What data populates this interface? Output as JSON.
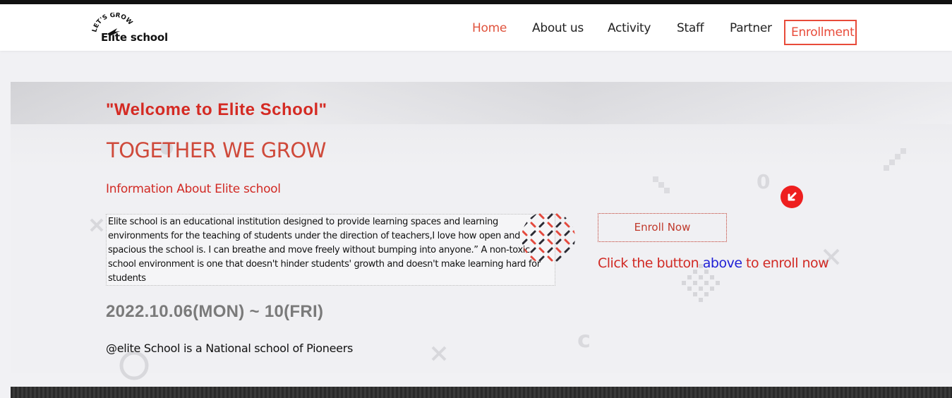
{
  "brand": {
    "arc_text": "LET'S GROW",
    "name": "Elite school"
  },
  "nav": {
    "home": "Home",
    "about": "About us",
    "activity": "Activity",
    "staff": "Staff",
    "partner": "Partner",
    "enrollment": "Enrollment"
  },
  "hero": {
    "welcome": "\"Welcome to Elite School\"",
    "tagline": "TOGETHER WE GROW",
    "info_heading": "Information About Elite school",
    "description": "Elite school is an educational institution designed to provide learning spaces and learning environments for the teaching of students under the direction of teachers,I love how open and spacious the school is. I can breathe and move freely without bumping into anyone.” A non-toxic school environment is one that doesn't hinder students' growth and doesn't make learning hard for students",
    "dates": "2022.10.06(MON) ~ 10(FRI)",
    "footer_note": "@elite School is a National school of Pioneers"
  },
  "enroll": {
    "button_label": "Enroll Now",
    "note_prefix": "Click the button ",
    "note_highlight": "above",
    "note_suffix": " to enroll now"
  },
  "colors": {
    "accent_red": "#d42a23",
    "nav_active": "#e0533d",
    "link_blue": "#1f1fd6"
  },
  "icons": {
    "logo": "rocket-logo-icon",
    "arrow": "arrow-down-circle-icon",
    "dots": "dotted-circle-pattern",
    "diamond": "dotted-diamond-pattern"
  }
}
